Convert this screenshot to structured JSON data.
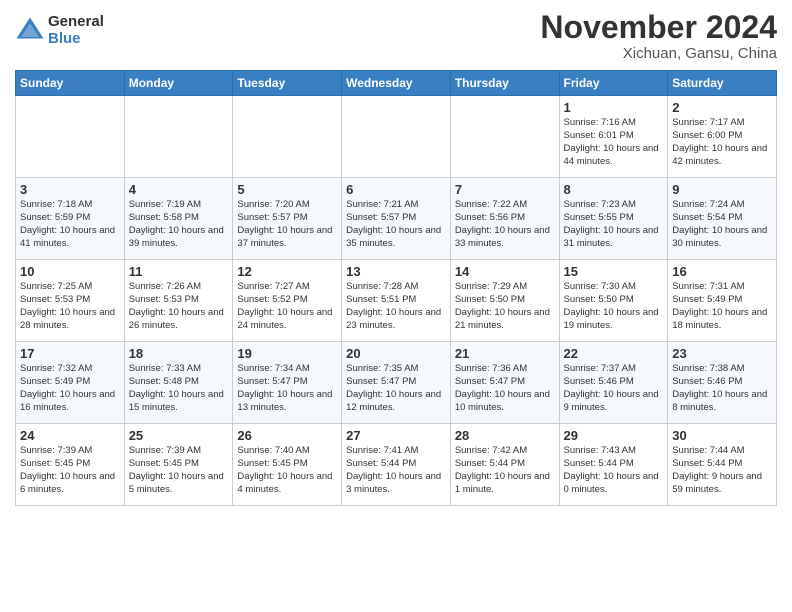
{
  "header": {
    "logo_general": "General",
    "logo_blue": "Blue",
    "month_title": "November 2024",
    "location": "Xichuan, Gansu, China"
  },
  "weekdays": [
    "Sunday",
    "Monday",
    "Tuesday",
    "Wednesday",
    "Thursday",
    "Friday",
    "Saturday"
  ],
  "weeks": [
    [
      {
        "day": "",
        "info": ""
      },
      {
        "day": "",
        "info": ""
      },
      {
        "day": "",
        "info": ""
      },
      {
        "day": "",
        "info": ""
      },
      {
        "day": "",
        "info": ""
      },
      {
        "day": "1",
        "info": "Sunrise: 7:16 AM\nSunset: 6:01 PM\nDaylight: 10 hours\nand 44 minutes."
      },
      {
        "day": "2",
        "info": "Sunrise: 7:17 AM\nSunset: 6:00 PM\nDaylight: 10 hours\nand 42 minutes."
      }
    ],
    [
      {
        "day": "3",
        "info": "Sunrise: 7:18 AM\nSunset: 5:59 PM\nDaylight: 10 hours\nand 41 minutes."
      },
      {
        "day": "4",
        "info": "Sunrise: 7:19 AM\nSunset: 5:58 PM\nDaylight: 10 hours\nand 39 minutes."
      },
      {
        "day": "5",
        "info": "Sunrise: 7:20 AM\nSunset: 5:57 PM\nDaylight: 10 hours\nand 37 minutes."
      },
      {
        "day": "6",
        "info": "Sunrise: 7:21 AM\nSunset: 5:57 PM\nDaylight: 10 hours\nand 35 minutes."
      },
      {
        "day": "7",
        "info": "Sunrise: 7:22 AM\nSunset: 5:56 PM\nDaylight: 10 hours\nand 33 minutes."
      },
      {
        "day": "8",
        "info": "Sunrise: 7:23 AM\nSunset: 5:55 PM\nDaylight: 10 hours\nand 31 minutes."
      },
      {
        "day": "9",
        "info": "Sunrise: 7:24 AM\nSunset: 5:54 PM\nDaylight: 10 hours\nand 30 minutes."
      }
    ],
    [
      {
        "day": "10",
        "info": "Sunrise: 7:25 AM\nSunset: 5:53 PM\nDaylight: 10 hours\nand 28 minutes."
      },
      {
        "day": "11",
        "info": "Sunrise: 7:26 AM\nSunset: 5:53 PM\nDaylight: 10 hours\nand 26 minutes."
      },
      {
        "day": "12",
        "info": "Sunrise: 7:27 AM\nSunset: 5:52 PM\nDaylight: 10 hours\nand 24 minutes."
      },
      {
        "day": "13",
        "info": "Sunrise: 7:28 AM\nSunset: 5:51 PM\nDaylight: 10 hours\nand 23 minutes."
      },
      {
        "day": "14",
        "info": "Sunrise: 7:29 AM\nSunset: 5:50 PM\nDaylight: 10 hours\nand 21 minutes."
      },
      {
        "day": "15",
        "info": "Sunrise: 7:30 AM\nSunset: 5:50 PM\nDaylight: 10 hours\nand 19 minutes."
      },
      {
        "day": "16",
        "info": "Sunrise: 7:31 AM\nSunset: 5:49 PM\nDaylight: 10 hours\nand 18 minutes."
      }
    ],
    [
      {
        "day": "17",
        "info": "Sunrise: 7:32 AM\nSunset: 5:49 PM\nDaylight: 10 hours\nand 16 minutes."
      },
      {
        "day": "18",
        "info": "Sunrise: 7:33 AM\nSunset: 5:48 PM\nDaylight: 10 hours\nand 15 minutes."
      },
      {
        "day": "19",
        "info": "Sunrise: 7:34 AM\nSunset: 5:47 PM\nDaylight: 10 hours\nand 13 minutes."
      },
      {
        "day": "20",
        "info": "Sunrise: 7:35 AM\nSunset: 5:47 PM\nDaylight: 10 hours\nand 12 minutes."
      },
      {
        "day": "21",
        "info": "Sunrise: 7:36 AM\nSunset: 5:47 PM\nDaylight: 10 hours\nand 10 minutes."
      },
      {
        "day": "22",
        "info": "Sunrise: 7:37 AM\nSunset: 5:46 PM\nDaylight: 10 hours\nand 9 minutes."
      },
      {
        "day": "23",
        "info": "Sunrise: 7:38 AM\nSunset: 5:46 PM\nDaylight: 10 hours\nand 8 minutes."
      }
    ],
    [
      {
        "day": "24",
        "info": "Sunrise: 7:39 AM\nSunset: 5:45 PM\nDaylight: 10 hours\nand 6 minutes."
      },
      {
        "day": "25",
        "info": "Sunrise: 7:39 AM\nSunset: 5:45 PM\nDaylight: 10 hours\nand 5 minutes."
      },
      {
        "day": "26",
        "info": "Sunrise: 7:40 AM\nSunset: 5:45 PM\nDaylight: 10 hours\nand 4 minutes."
      },
      {
        "day": "27",
        "info": "Sunrise: 7:41 AM\nSunset: 5:44 PM\nDaylight: 10 hours\nand 3 minutes."
      },
      {
        "day": "28",
        "info": "Sunrise: 7:42 AM\nSunset: 5:44 PM\nDaylight: 10 hours\nand 1 minute."
      },
      {
        "day": "29",
        "info": "Sunrise: 7:43 AM\nSunset: 5:44 PM\nDaylight: 10 hours\nand 0 minutes."
      },
      {
        "day": "30",
        "info": "Sunrise: 7:44 AM\nSunset: 5:44 PM\nDaylight: 9 hours\nand 59 minutes."
      }
    ]
  ]
}
